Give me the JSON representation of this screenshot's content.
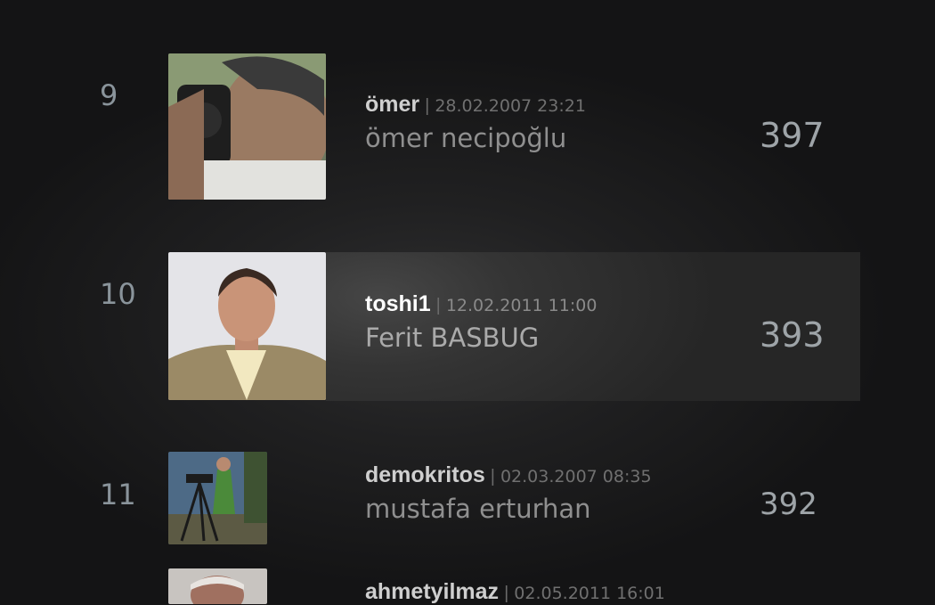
{
  "entries": [
    {
      "rank": "9",
      "username": "ömer",
      "separator": "|",
      "date": "28.02.2007 23:21",
      "realname": "ömer necipoğlu",
      "score": "397"
    },
    {
      "rank": "10",
      "username": "toshi1",
      "separator": "|",
      "date": "12.02.2011 11:00",
      "realname": "Ferit BASBUG",
      "score": "393"
    },
    {
      "rank": "11",
      "username": "demokritos",
      "separator": "|",
      "date": "02.03.2007 08:35",
      "realname": "mustafa erturhan",
      "score": "392"
    },
    {
      "username": "ahmetyilmaz",
      "separator": "|",
      "date": "02.05.2011 16:01"
    }
  ],
  "colors": {
    "highlight_row": "#3a3a3a",
    "username": "#cfcfcf",
    "username_highlight": "#ffffff",
    "rank": "#8a949b"
  }
}
